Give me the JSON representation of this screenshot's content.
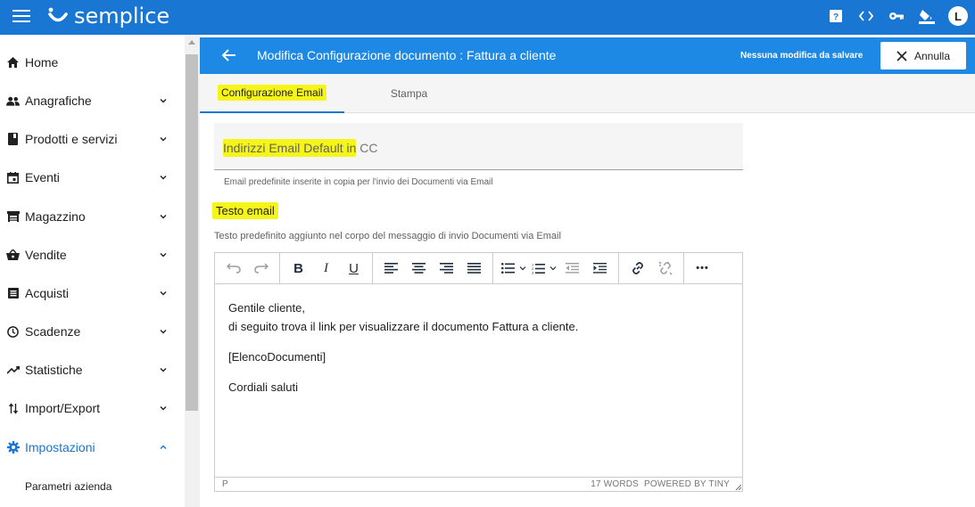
{
  "topbar": {
    "app_name": "semplice",
    "avatar_letter": "L",
    "icons": [
      "help-icon",
      "code-icon",
      "key-icon",
      "paint-bucket-icon"
    ],
    "color": "#1976d2"
  },
  "sidebar": {
    "items": [
      {
        "label": "Home",
        "icon": "home-icon"
      },
      {
        "label": "Anagrafiche",
        "icon": "people-icon"
      },
      {
        "label": "Prodotti e servizi",
        "icon": "book-icon"
      },
      {
        "label": "Eventi",
        "icon": "calendar-icon"
      },
      {
        "label": "Magazzino",
        "icon": "warehouse-icon"
      },
      {
        "label": "Vendite",
        "icon": "basket-icon"
      },
      {
        "label": "Acquisti",
        "icon": "list-icon"
      },
      {
        "label": "Scadenze",
        "icon": "clock-icon"
      },
      {
        "label": "Statistiche",
        "icon": "trend-icon"
      },
      {
        "label": "Import/Export",
        "icon": "import-export-icon"
      },
      {
        "label": "Impostazioni",
        "icon": "gear-icon"
      }
    ],
    "sub_items": [
      {
        "label": "Parametri azienda"
      }
    ],
    "active_color": "#1976d2"
  },
  "header": {
    "title": "Modifica Configurazione documento : Fattura a cliente",
    "status": "Nessuna modifica da salvare",
    "cancel_label": "Annulla",
    "color": "#1e88e5"
  },
  "tabs": [
    {
      "label": "Configurazione Email"
    },
    {
      "label": "Stampa"
    }
  ],
  "form": {
    "cc_label": "Indirizzi Email Default in CC",
    "cc_hint": "Email predefinite inserite in copia per l'invio dei Documenti via Email",
    "email_title": "Testo email",
    "email_desc": "Testo predefinito aggiunto nel corpo del messaggio di invio Documenti via Email"
  },
  "editor": {
    "lines": [
      "Gentile cliente,",
      "di seguito trova il link per visualizzare il documento Fattura a cliente.",
      "[ElencoDocumenti]",
      "Cordiali saluti"
    ],
    "status_path": "P",
    "word_count": "17 WORDS",
    "powered": "POWERED BY TINY",
    "toolbar": {
      "bold": "B",
      "italic": "I",
      "underline": "U",
      "more": "•••"
    }
  },
  "highlight_color": "#f6f51a"
}
